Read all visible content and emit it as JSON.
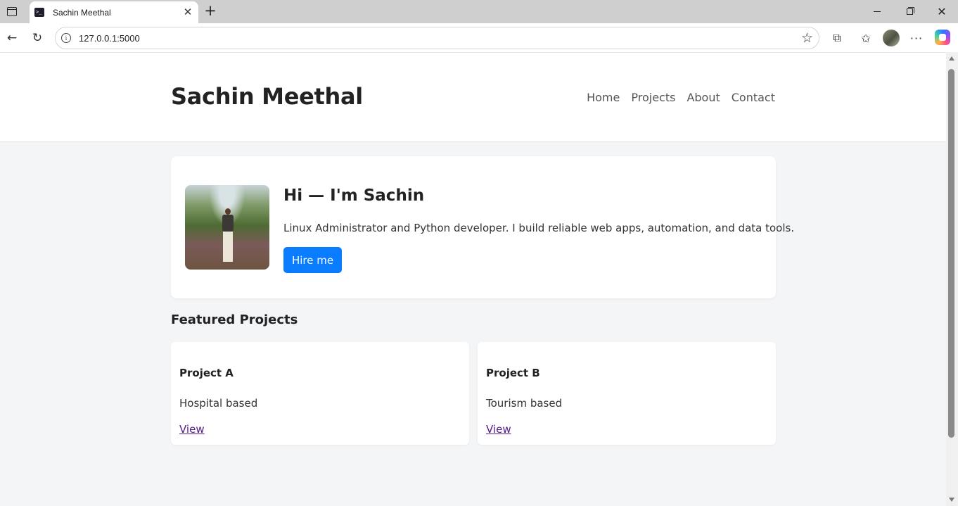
{
  "browser": {
    "tab_title": "Sachin Meethal",
    "favicon_text": ">_",
    "url": "127.0.0.1:5000"
  },
  "site": {
    "brand": "Sachin Meethal",
    "nav": [
      "Home",
      "Projects",
      "About",
      "Contact"
    ]
  },
  "hero": {
    "heading": "Hi — I'm Sachin",
    "description": "Linux Administrator and Python developer. I build reliable web apps, automation, and data tools.",
    "cta_label": "Hire me",
    "cta_color": "#0a7cff"
  },
  "projects": {
    "title": "Featured Projects",
    "items": [
      {
        "name": "Project A",
        "description": "Hospital based",
        "link_label": "View"
      },
      {
        "name": "Project B",
        "description": "Tourism based",
        "link_label": "View"
      }
    ]
  }
}
